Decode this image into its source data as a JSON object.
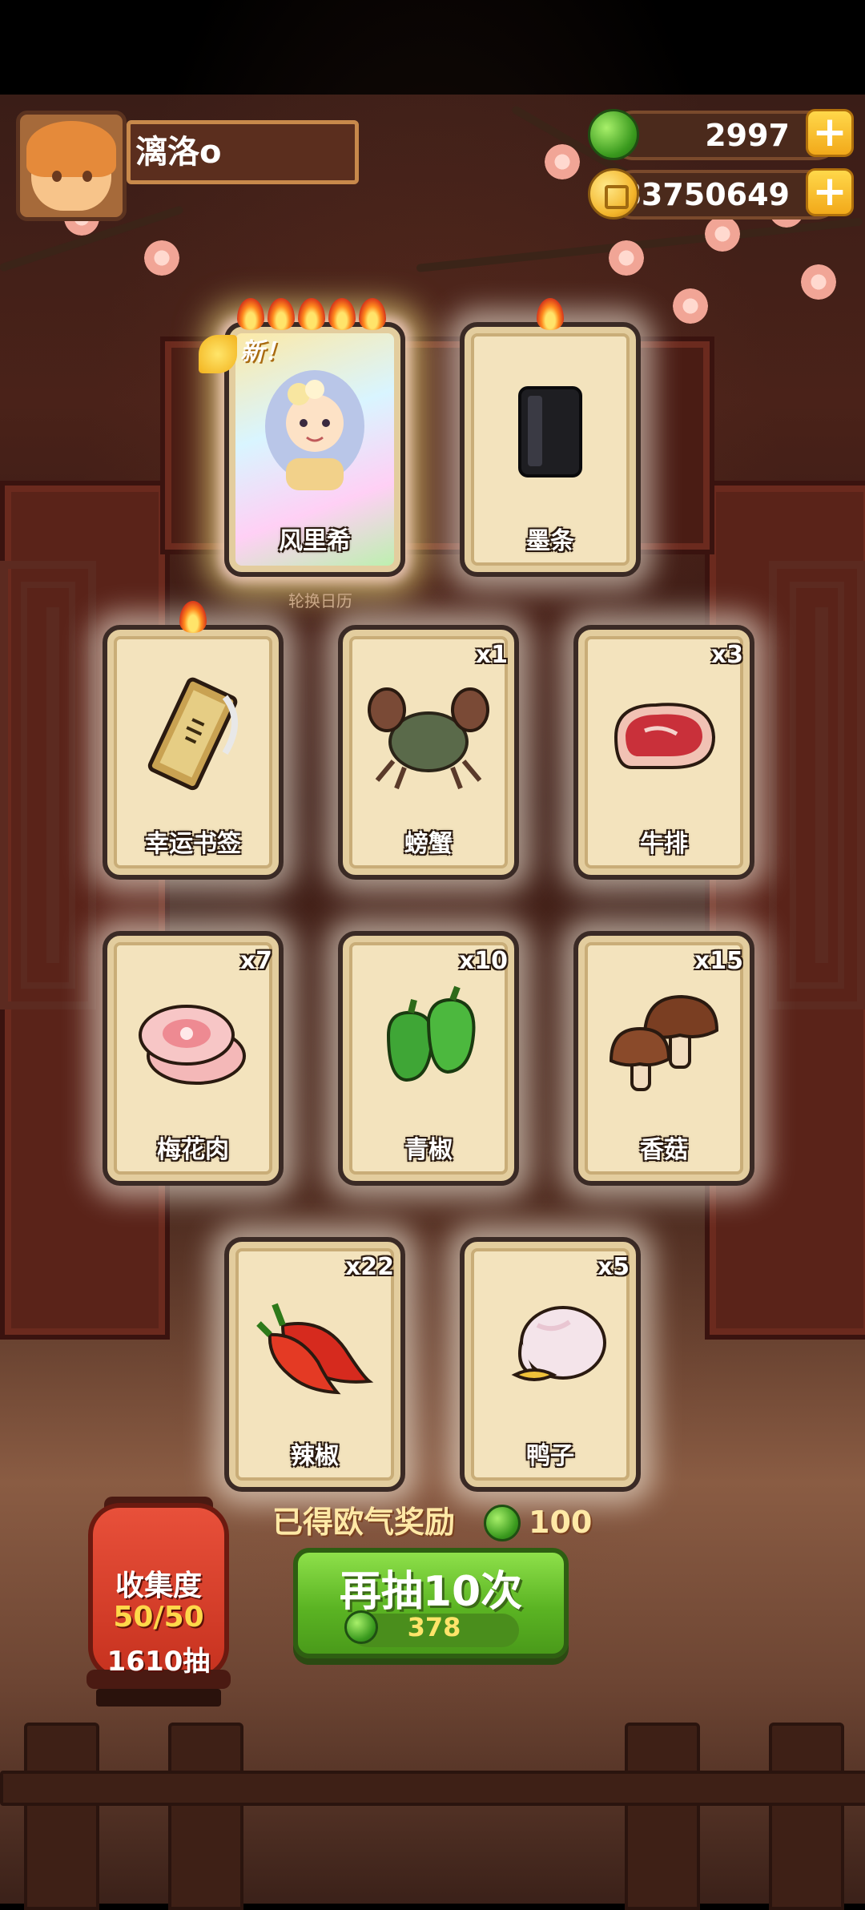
{
  "player": {
    "name": "漓洛o"
  },
  "resources": {
    "gems": "2997",
    "coins": "83750649",
    "gem_icon": "green-jade-gem-icon",
    "coin_icon": "gold-coin-icon"
  },
  "cards": [
    {
      "name": "风里希",
      "count": "",
      "stars": 5,
      "new_label": "新！",
      "icon": "character-portrait"
    },
    {
      "name": "墨条",
      "count": "",
      "stars": 1,
      "icon": "ink-stick-icon"
    },
    {
      "name": "幸运书签",
      "count": "",
      "stars": 1,
      "icon": "bookmark-icon"
    },
    {
      "name": "螃蟹",
      "count": "x1",
      "stars": 0,
      "icon": "crab-icon"
    },
    {
      "name": "牛排",
      "count": "x3",
      "stars": 0,
      "icon": "steak-icon"
    },
    {
      "name": "梅花肉",
      "count": "x7",
      "stars": 0,
      "icon": "pork-icon"
    },
    {
      "name": "青椒",
      "count": "x10",
      "stars": 0,
      "icon": "green-pepper-icon"
    },
    {
      "name": "香菇",
      "count": "x15",
      "stars": 0,
      "icon": "mushroom-icon"
    },
    {
      "name": "辣椒",
      "count": "x22",
      "stars": 0,
      "icon": "chili-icon"
    },
    {
      "name": "鸭子",
      "count": "x5",
      "stars": 0,
      "icon": "duck-icon"
    }
  ],
  "background_label": "轮换日历",
  "reward": {
    "label": "已得欧气奖励",
    "value": "100"
  },
  "draw_button": {
    "label": "再抽10次",
    "cost": "378"
  },
  "collection": {
    "title": "收集度",
    "progress": "50/50",
    "draws": "1610抽"
  },
  "colors": {
    "accent_green": "#5bb423",
    "gold": "#f2a91a",
    "card_bg": "#f3e3bd"
  }
}
